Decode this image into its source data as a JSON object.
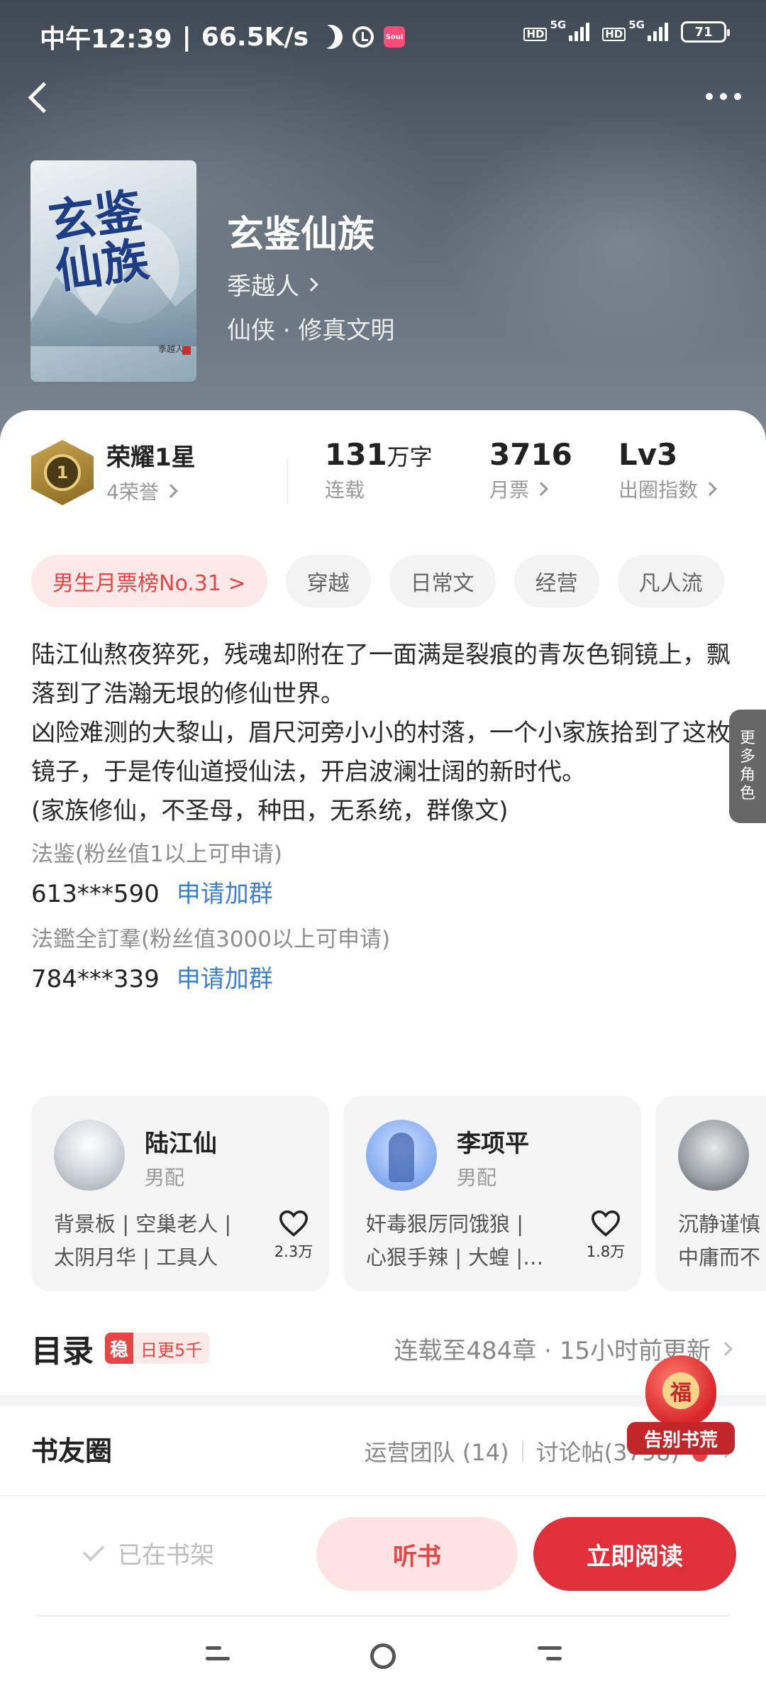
{
  "status_bar": {
    "time": "中午12:39",
    "speed": "66.5K/s",
    "app_badge": "Soul",
    "network1": "5G",
    "network2": "5G",
    "battery": "71"
  },
  "book": {
    "title": "玄鉴仙族",
    "cover_title": "玄鉴仙族",
    "cover_author": "季越人",
    "author": "季越人",
    "genre": "仙侠 · 修真文明"
  },
  "stats": {
    "honor_title": "荣耀1星",
    "honor_sub": "4荣誉",
    "honor_medal": "1",
    "words_value": "131",
    "words_unit": "万字",
    "words_label": "连载",
    "votes_value": "3716",
    "votes_label": "月票",
    "level_value": "Lv3",
    "level_label": "出圈指数"
  },
  "tags": [
    "男生月票榜No.31 >",
    "穿越",
    "日常文",
    "经营",
    "凡人流"
  ],
  "intro": {
    "lines": [
      "陆江仙熬夜猝死，残魂却附在了一面满是裂痕的青灰色铜镜上，飘落到了浩瀚无垠的修仙世界。",
      "凶险难测的大黎山，眉尺河旁小小的村落，一个小家族拾到了这枚镜子，于是传仙道授仙法，开启波澜壮阔的新时代。",
      "(家族修仙，不圣母，种田，无系统，群像文)"
    ],
    "groups": [
      {
        "label": "法鉴(粉丝值1以上可申请)",
        "number": "613***590",
        "action": "申请加群"
      },
      {
        "label": "法鑑全訂羣(粉丝值3000以上可申请)",
        "number": "784***339",
        "action": "申请加群"
      }
    ]
  },
  "roles": [
    {
      "name": "陆江仙",
      "type": "男配",
      "tags1": "背景板 | 空巢老人 |",
      "tags2": "太阴月华 | 工具人",
      "likes": "2.3万"
    },
    {
      "name": "李项平",
      "type": "男配",
      "tags1": "奸毒狠厉同饿狼 |",
      "tags2": "心狠手辣 | 大蝗 |…",
      "likes": "1.8万"
    },
    {
      "name": "",
      "type": "",
      "tags1": "沉静谨慎",
      "tags2": "中庸而不",
      "likes": ""
    }
  ],
  "more_roles": "更多角色",
  "toc": {
    "title": "目录",
    "badge_icon": "稳",
    "badge_text": "日更5千",
    "update": "连载至484章 · 15小时前更新"
  },
  "circle": {
    "title": "书友圈",
    "team": "运营团队 (14)",
    "posts": "讨论帖(3798)"
  },
  "fortune": {
    "label": "告别书荒"
  },
  "bottom": {
    "shelf": "已在书架",
    "listen": "听书",
    "read": "立即阅读"
  },
  "colors": {
    "accent": "#e0313a",
    "tag_rank_bg": "#fde9e8",
    "link": "#3f7fd1"
  }
}
